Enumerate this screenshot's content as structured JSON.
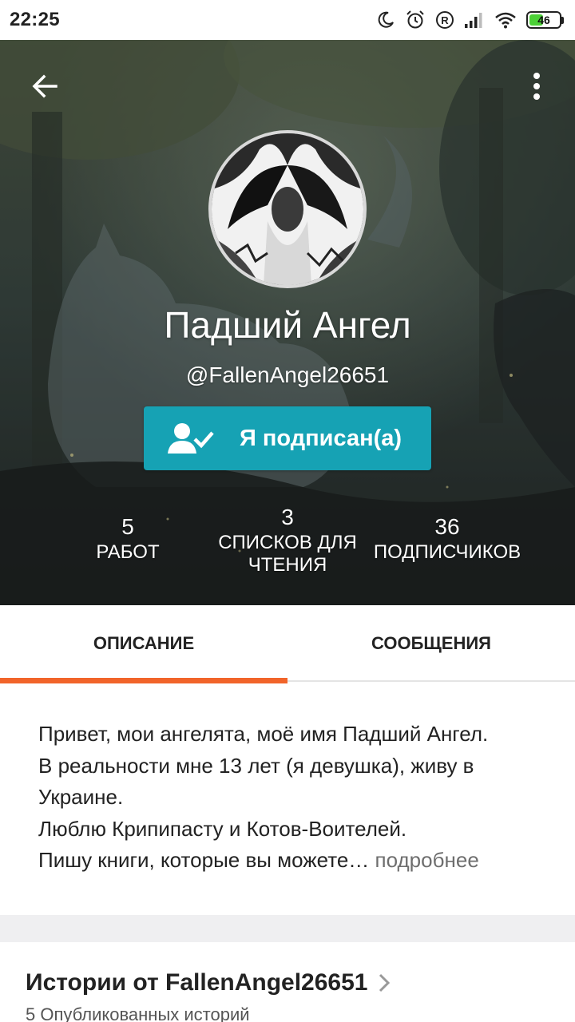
{
  "status_bar": {
    "time": "22:25",
    "battery": "46",
    "icons": [
      "moon-icon",
      "alarm-icon",
      "registered-icon",
      "signal-icon",
      "wifi-icon",
      "battery-icon"
    ]
  },
  "toolbar": {
    "back_icon": "arrow-left-icon",
    "more_icon": "more-vertical-icon"
  },
  "profile": {
    "display_name": "Падший Ангел",
    "username": "@FallenAngel26651",
    "follow_label": "Я подписан(а)",
    "follow_icon": "user-check-icon",
    "accent_color": "#16a2b4"
  },
  "stats": [
    {
      "value": "5",
      "label": "РАБОТ"
    },
    {
      "value": "3",
      "label_line1": "СПИСКОВ ДЛЯ",
      "label_line2": "ЧТЕНИЯ"
    },
    {
      "value": "36",
      "label": "ПОДПИСЧИКОВ"
    }
  ],
  "tabs": [
    {
      "label": "ОПИСАНИЕ",
      "active": true
    },
    {
      "label": "СООБЩЕНИЯ",
      "active": false
    }
  ],
  "tab_indicator_color": "#f1642a",
  "description": {
    "lines": [
      "Привет, мои ангелята, моё имя Падший Ангел.",
      "В реальности мне 13 лет (я девушка), живу в",
      "Украине.",
      "Люблю Крипипасту и Котов-Воителей.",
      "Пишу книги, которые вы можете…"
    ],
    "more_label": "подробнее"
  },
  "stories": {
    "title": "Истории от FallenAngel26651",
    "subtitle": "5 Опубликованных историй"
  }
}
